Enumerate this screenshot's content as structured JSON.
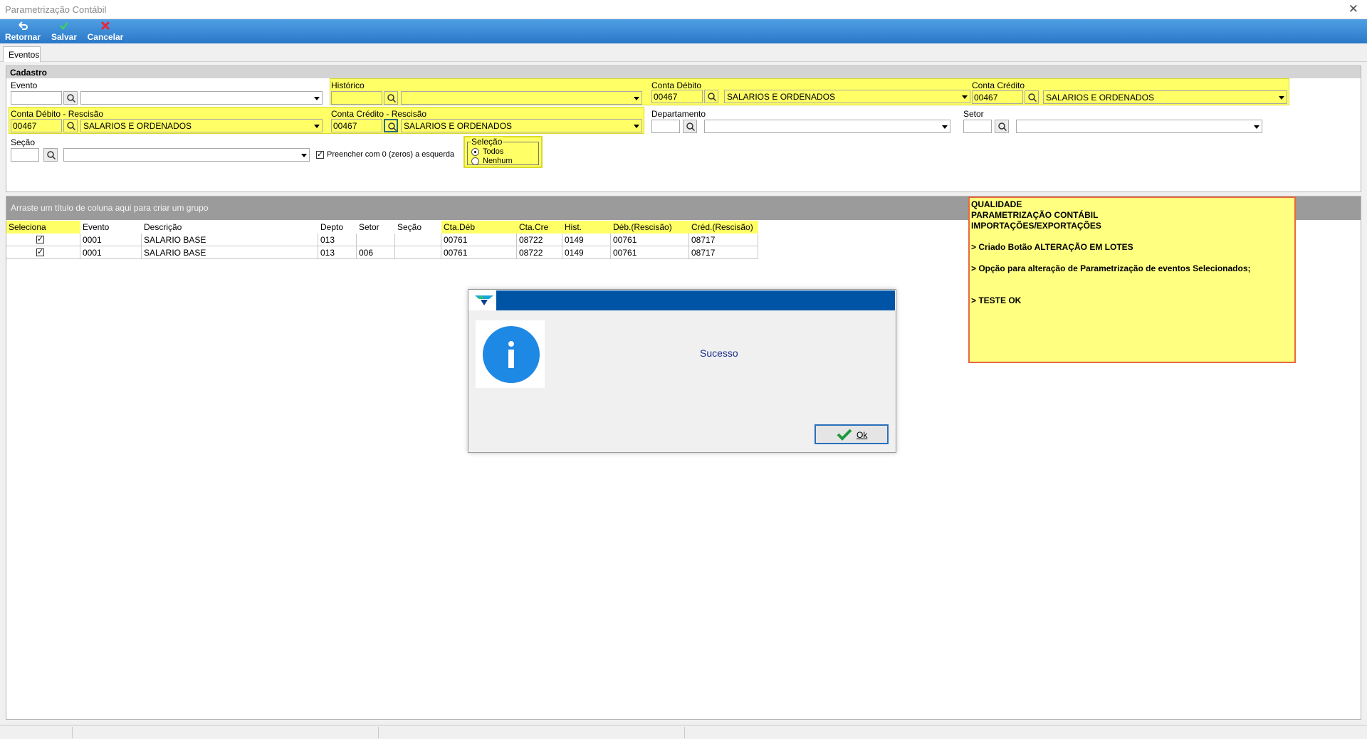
{
  "window": {
    "title": "Parametrização Contábil"
  },
  "toolbar": {
    "back_label": "Retornar",
    "save_label": "Salvar",
    "cancel_label": "Cancelar"
  },
  "tabs": [
    {
      "label": "Eventos"
    }
  ],
  "cadastro": {
    "header": "Cadastro",
    "evento": {
      "label": "Evento",
      "code": "",
      "desc": ""
    },
    "historico": {
      "label": "Histórico",
      "code": "",
      "desc": ""
    },
    "conta_debito": {
      "label": "Conta Débito",
      "code": "00467",
      "desc": "SALARIOS E ORDENADOS"
    },
    "conta_credito": {
      "label": "Conta Crédito",
      "code": "00467",
      "desc": "SALARIOS E ORDENADOS"
    },
    "conta_debito_rescisao": {
      "label": "Conta Débito - Rescisão",
      "code": "00467",
      "desc": "SALARIOS E ORDENADOS"
    },
    "conta_credito_rescisao": {
      "label": "Conta Crédito - Rescisão",
      "code": "00467",
      "desc": "SALARIOS E ORDENADOS"
    },
    "departamento": {
      "label": "Departamento",
      "code": "",
      "desc": ""
    },
    "setor": {
      "label": "Setor",
      "code": "",
      "desc": ""
    },
    "secao": {
      "label": "Seção",
      "code": "",
      "desc": ""
    },
    "preencher": {
      "label": "Preencher com 0 (zeros) a esquerda",
      "checked": true
    },
    "selecao": {
      "title": "Seleção",
      "options": [
        "Todos",
        "Nenhum"
      ],
      "selected": "Todos"
    }
  },
  "grid": {
    "group_hint": "Arraste um título de coluna aqui para criar um grupo",
    "columns": [
      "Seleciona",
      "Evento",
      "Descrição",
      "Depto",
      "Setor",
      "Seção",
      "Cta.Déb",
      "Cta.Cre",
      "Hist.",
      "Déb.(Rescisão)",
      "Créd.(Rescisão)"
    ],
    "rows": [
      {
        "selected": true,
        "evento": "0001",
        "descricao": "SALARIO BASE",
        "depto": "013",
        "setor": "",
        "secao": "",
        "cta_deb": "00761",
        "cta_cre": "08722",
        "hist": "0149",
        "deb_resc": "00761",
        "cred_resc": "08717"
      },
      {
        "selected": true,
        "evento": "0001",
        "descricao": "SALARIO BASE",
        "depto": "013",
        "setor": "006",
        "secao": "",
        "cta_deb": "00761",
        "cta_cre": "08722",
        "hist": "0149",
        "deb_resc": "00761",
        "cred_resc": "08717"
      }
    ]
  },
  "note": {
    "lines": [
      "QUALIDADE",
      "PARAMETRIZAÇÃO CONTÁBIL",
      "IMPORTAÇÕES/EXPORTAÇÕES",
      "> Criado Botão ALTERAÇÃO EM LOTES",
      "> Opção para alteração de Parametrização de eventos Selecionados;",
      "> TESTE OK"
    ]
  },
  "dialog": {
    "message": "Sucesso",
    "ok_label": "Ok"
  },
  "colors": {
    "highlight": "#ffff66",
    "toolbar": "#3b8ad6",
    "dialog_bar": "#0054a6",
    "info_icon": "#1e88e5",
    "note_border": "#e56a3e"
  }
}
